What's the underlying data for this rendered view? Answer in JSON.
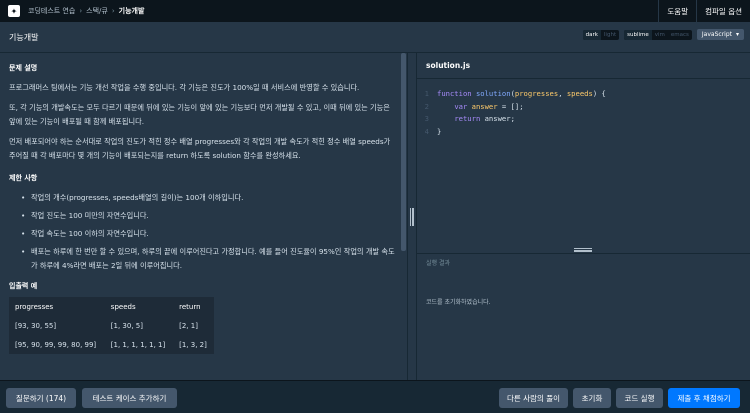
{
  "header": {
    "logo_glyph": "✦",
    "breadcrumb": [
      "코딩테스트 연습",
      "스택/큐",
      "기능개발"
    ],
    "sep": "›",
    "menu": [
      "도움말",
      "컴파일 옵션"
    ]
  },
  "titlebar": {
    "title": "기능개발",
    "theme_a": [
      "dark",
      "light"
    ],
    "theme_b": [
      "sublime",
      "vim",
      "emacs"
    ],
    "language": "JavaScript",
    "language_caret": "▾"
  },
  "problem": {
    "h_desc": "문제 설명",
    "p1": "프로그래머스 팀에서는 기능 개선 작업을 수행 중입니다. 각 기능은 진도가 100%일 때 서비스에 반영할 수 있습니다.",
    "p2": "또, 각 기능의 개발속도는 모두 다르기 때문에 뒤에 있는 기능이 앞에 있는 기능보다 먼저 개발될 수 있고, 이때 뒤에 있는 기능은 앞에 있는 기능이 배포될 때 함께 배포됩니다.",
    "p3": "먼저 배포되어야 하는 순서대로 작업의 진도가 적힌 정수 배열 progresses와 각 작업의 개발 속도가 적힌 정수 배열 speeds가 주어질 때 각 배포마다 몇 개의 기능이 배포되는지를 return 하도록 solution 함수를 완성하세요.",
    "h_limit": "제한 사항",
    "limits": [
      "작업의 개수(progresses, speeds배열의 길이)는 100개 이하입니다.",
      "작업 진도는 100 미만의 자연수입니다.",
      "작업 속도는 100 이하의 자연수입니다.",
      "배포는 하루에 한 번만 할 수 있으며, 하루의 끝에 이루어진다고 가정합니다. 예를 들어 진도율이 95%인 작업의 개발 속도가 하루에 4%라면 배포는 2일 뒤에 이루어집니다."
    ],
    "h_io": "입출력 예",
    "io_headers": [
      "progresses",
      "speeds",
      "return"
    ],
    "io_rows": [
      [
        "[93, 30, 55]",
        "[1, 30, 5]",
        "[2, 1]"
      ],
      [
        "[95, 90, 99, 99, 80, 99]",
        "[1, 1, 1, 1, 1, 1]",
        "[1, 3, 2]"
      ]
    ]
  },
  "editor": {
    "filename": "solution.js",
    "line_numbers": [
      "1",
      "2",
      "3",
      "4"
    ],
    "kw_function": "function",
    "fn_name": "solution",
    "param1": "progresses",
    "param2": "speeds",
    "kw_var": "var",
    "var_name": "answer",
    "kw_return": "return"
  },
  "result": {
    "header": "실행 결과",
    "message": "코드를 초기화하였습니다."
  },
  "footer": {
    "questions": "질문하기 (174)",
    "add_test": "테스트 케이스 추가하기",
    "others": "다른 사람의 풀이",
    "reset": "초기화",
    "run": "코드 실행",
    "submit": "제출 후 채점하기"
  }
}
